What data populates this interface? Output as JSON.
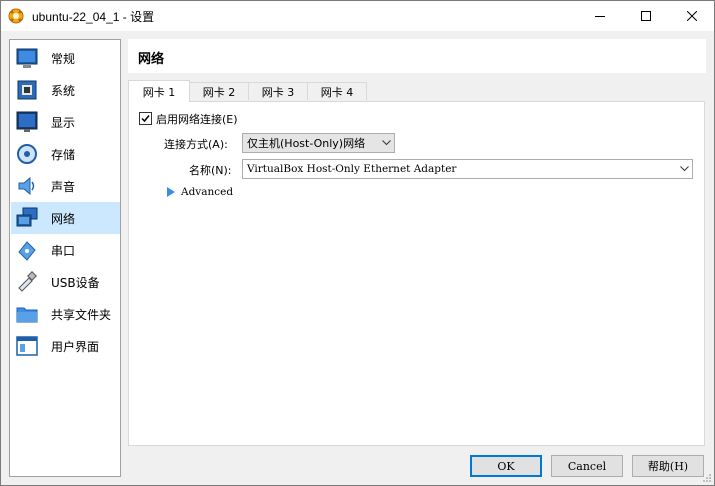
{
  "window": {
    "title": "ubuntu-22_04_1 - 设置"
  },
  "sidebar": {
    "items": [
      {
        "label": "常规",
        "icon": "general-icon"
      },
      {
        "label": "系统",
        "icon": "system-icon"
      },
      {
        "label": "显示",
        "icon": "display-icon"
      },
      {
        "label": "存储",
        "icon": "storage-icon"
      },
      {
        "label": "声音",
        "icon": "audio-icon"
      },
      {
        "label": "网络",
        "icon": "network-icon",
        "selected": true
      },
      {
        "label": "串口",
        "icon": "serial-port-icon"
      },
      {
        "label": "USB设备",
        "icon": "usb-icon"
      },
      {
        "label": "共享文件夹",
        "icon": "shared-folder-icon"
      },
      {
        "label": "用户界面",
        "icon": "user-interface-icon"
      }
    ]
  },
  "header": {
    "title": "网络"
  },
  "tabs": [
    {
      "label": "网卡 1",
      "active": true
    },
    {
      "label": "网卡 2"
    },
    {
      "label": "网卡 3"
    },
    {
      "label": "网卡 4"
    }
  ],
  "adapter": {
    "enable_label": "启用网络连接(E)",
    "enabled": true,
    "attached_label": "连接方式(A):",
    "attached_value": "仅主机(Host-Only)网络",
    "name_label": "名称(N):",
    "name_value": "VirtualBox Host-Only Ethernet Adapter",
    "advanced_label": "Advanced"
  },
  "buttons": {
    "ok": "OK",
    "cancel": "Cancel",
    "help": "帮助(H)"
  },
  "colors": {
    "selection": "#cce8ff",
    "accent": "#0078d7"
  }
}
